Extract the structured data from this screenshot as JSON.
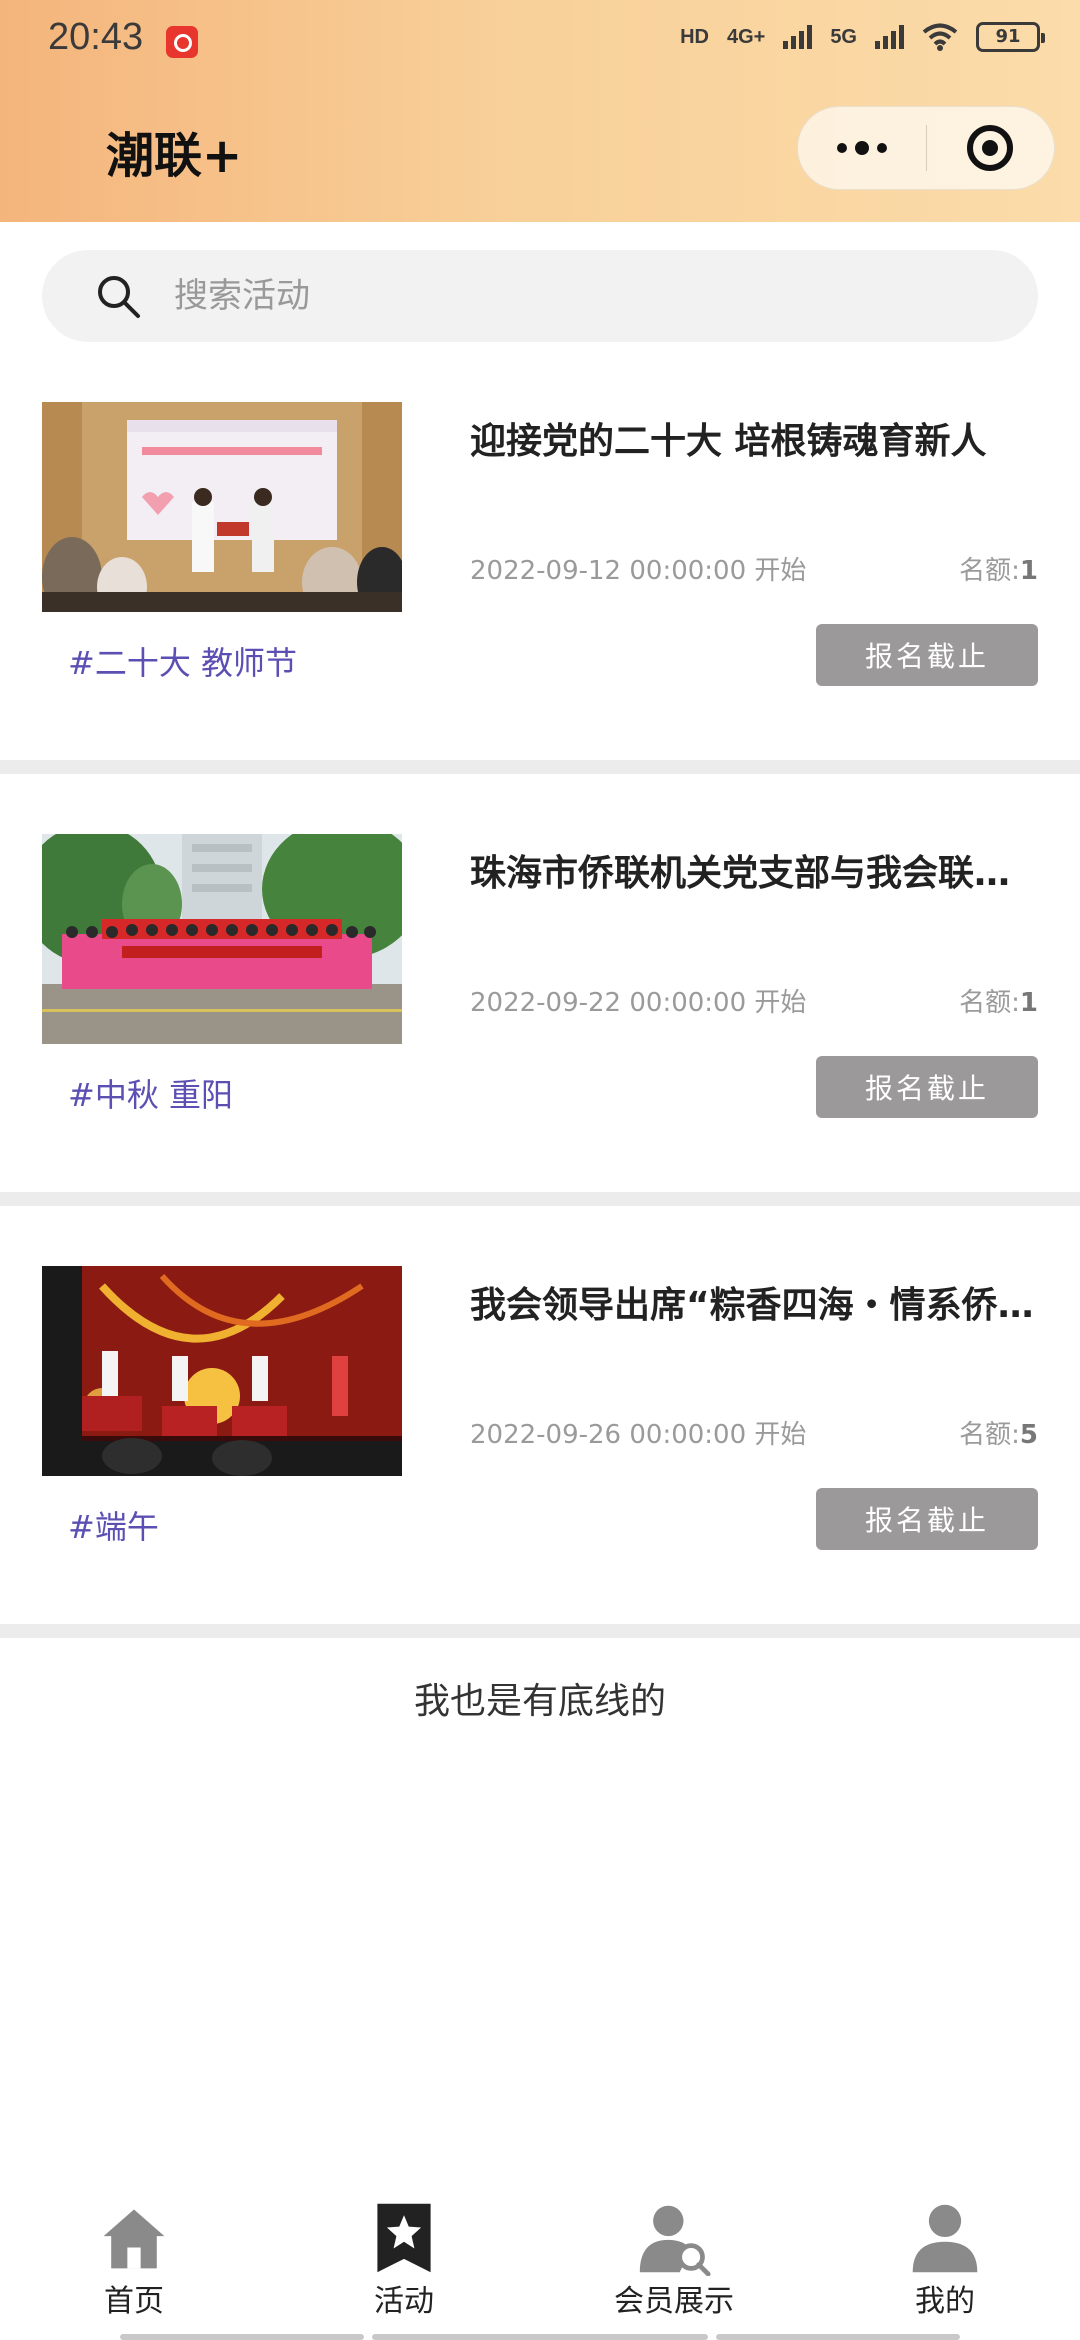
{
  "status_bar": {
    "time": "20:43",
    "battery": "91",
    "network_1": "4G+",
    "network_2": "5G",
    "hd": "HD"
  },
  "header": {
    "title": "潮联+"
  },
  "search": {
    "placeholder": "搜索活动"
  },
  "activities": [
    {
      "title": "迎接党的二十大 培根铸魂育新人",
      "start": "2022-09-12 00:00:00 开始",
      "quota_label": "名额:",
      "quota": "1",
      "tags": "#二十大 教师节",
      "button": "报名截止"
    },
    {
      "title": "珠海市侨联机关党支部与我会联合开展活动",
      "start": "2022-09-22 00:00:00 开始",
      "quota_label": "名额:",
      "quota": "1",
      "tags": "#中秋 重阳",
      "button": "报名截止"
    },
    {
      "title": "我会领导出席“粽香四海・情系侨胞”活动",
      "start": "2022-09-26 00:00:00 开始",
      "quota_label": "名额:",
      "quota": "5",
      "tags": "#端午",
      "button": "报名截止"
    }
  ],
  "footer_text": "我也是有底线的",
  "tabbar": {
    "items": [
      {
        "label": "首页",
        "icon": "home-icon",
        "active": false
      },
      {
        "label": "活动",
        "icon": "star-bookmark-icon",
        "active": true
      },
      {
        "label": "会员展示",
        "icon": "member-search-icon",
        "active": false
      },
      {
        "label": "我的",
        "icon": "user-icon",
        "active": false
      }
    ]
  },
  "colors": {
    "header_start": "#f4b57c",
    "header_end": "#fbdcaa",
    "tag": "#5b4fb3",
    "button_disabled": "#9b9999"
  }
}
